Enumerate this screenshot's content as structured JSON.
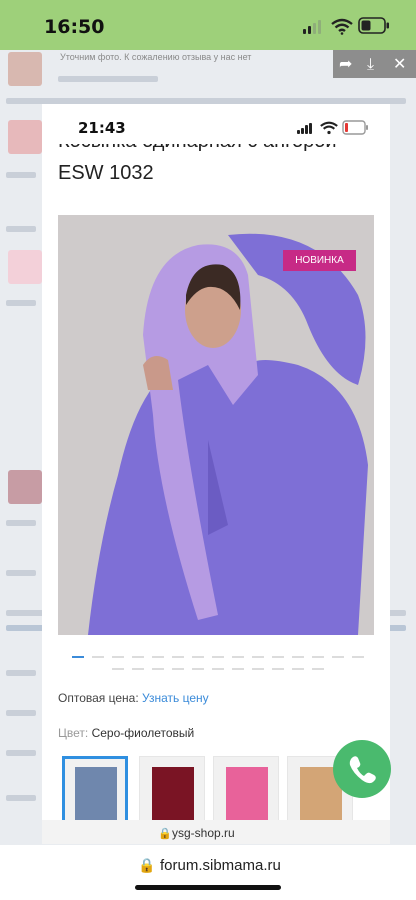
{
  "status_bar": {
    "time": "16:50"
  },
  "forum_page": {
    "reply_text": "Уточним фото. К сожалению отзыва у нас нет",
    "url": "forum.sibmama.ru"
  },
  "screenshot": {
    "time": "21:43",
    "product": {
      "title_line1": "Косынка одинарная с ангорой",
      "title_line2": "ESW 1032",
      "badge": "НОВИНКА",
      "wholesale_label": "Оптовая цена:",
      "wholesale_link": "Узнать цену",
      "color_label": "Цвет:",
      "color_value": "Серо-фиолетовый",
      "swatches": [
        "#6f87ad",
        "#7a1424",
        "#e8629a",
        "#d3a576"
      ]
    },
    "url": "ysg-shop.ru"
  },
  "colors": {
    "status_bar": "#9ed07a",
    "badge": "#c72a86",
    "call_button": "#4aba6e",
    "link": "#3b8bd9",
    "sweater": "#7e6fd6",
    "scarf": "#b69be3"
  }
}
